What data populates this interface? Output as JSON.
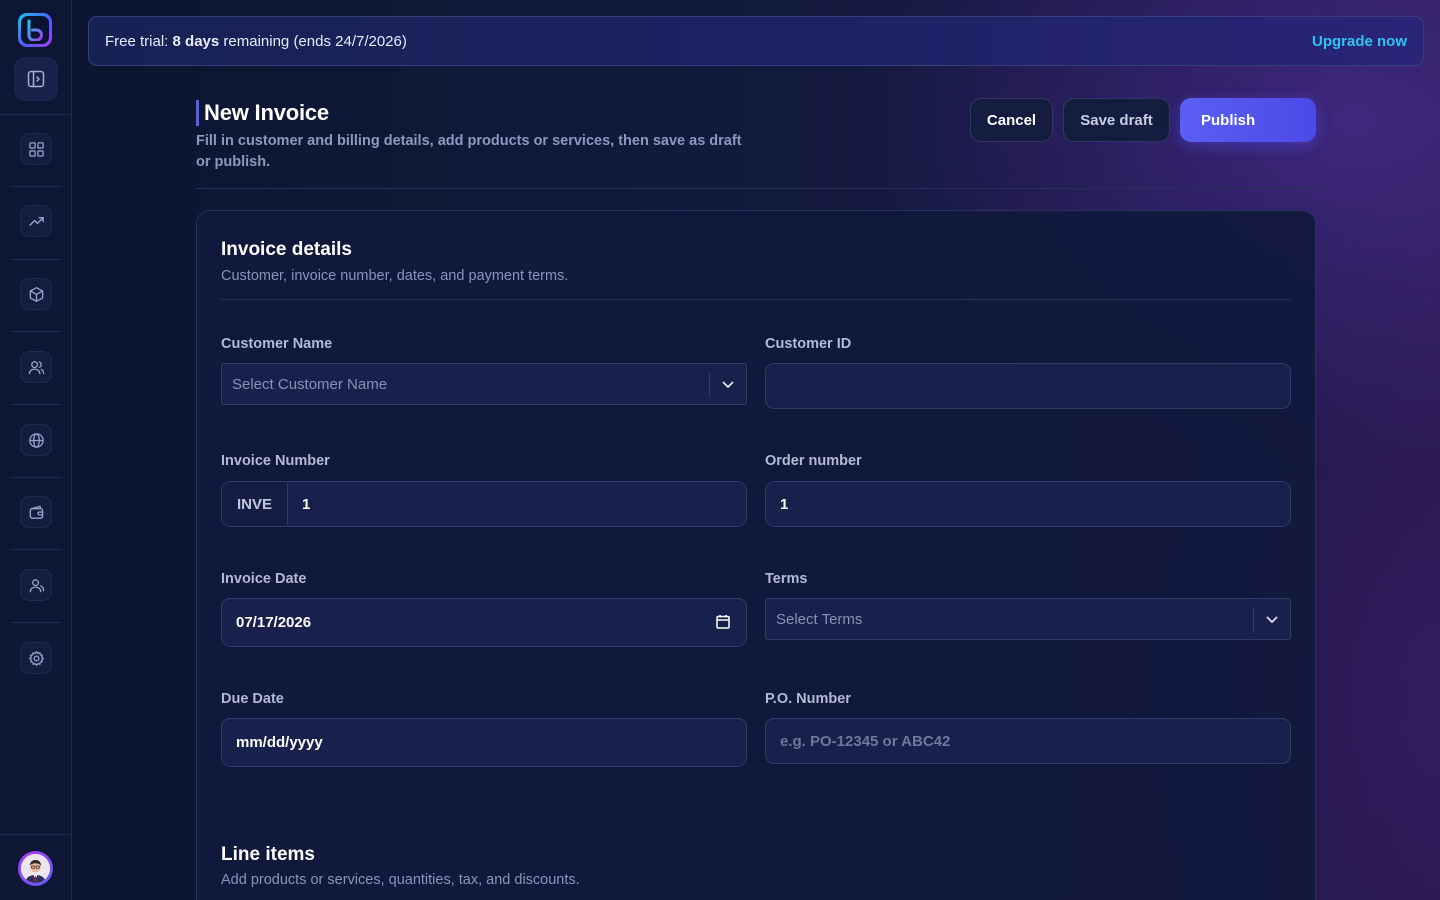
{
  "banner": {
    "prefix": "Free trial:",
    "days": "8 days",
    "suffix": "remaining (ends 24/7/2026)",
    "upgrade_label": "Upgrade now"
  },
  "sidebar": {
    "items": [
      {
        "name": "dashboard",
        "icon": "grid-icon"
      },
      {
        "name": "analytics",
        "icon": "trending-up-icon"
      },
      {
        "name": "products",
        "icon": "cube-icon"
      },
      {
        "name": "customers",
        "icon": "users-icon"
      },
      {
        "name": "web",
        "icon": "globe-icon"
      },
      {
        "name": "wallet",
        "icon": "wallet-icon"
      },
      {
        "name": "team",
        "icon": "user-group-icon"
      },
      {
        "name": "settings",
        "icon": "gear-icon"
      }
    ]
  },
  "header": {
    "title": "New Invoice",
    "subtitle": "Fill in customer and billing details, add products or services, then save as draft or publish.",
    "cancel_label": "Cancel",
    "save_draft_label": "Save draft",
    "publish_label": "Publish"
  },
  "invoice_details": {
    "title": "Invoice details",
    "subtitle": "Customer, invoice number, dates, and payment terms.",
    "customer_name": {
      "label": "Customer Name",
      "placeholder": "Select Customer Name",
      "value": ""
    },
    "customer_id": {
      "label": "Customer ID",
      "value": ""
    },
    "invoice_number": {
      "label": "Invoice Number",
      "prefix": "INVE",
      "value": "1"
    },
    "order_number": {
      "label": "Order number",
      "value": "1"
    },
    "invoice_date": {
      "label": "Invoice Date",
      "value": "07/17/2026"
    },
    "terms": {
      "label": "Terms",
      "placeholder": "Select Terms",
      "value": ""
    },
    "due_date": {
      "label": "Due Date",
      "value": "mm/dd/yyyy"
    },
    "po_number": {
      "label": "P.O. Number",
      "placeholder": "e.g. PO-12345 or ABC42",
      "value": ""
    }
  },
  "line_items": {
    "title": "Line items",
    "subtitle": "Add products or services, quantities, tax, and discounts."
  },
  "colors": {
    "accent": "#5a5ff2",
    "link": "#2ec4f2",
    "background": "#0f1838"
  }
}
